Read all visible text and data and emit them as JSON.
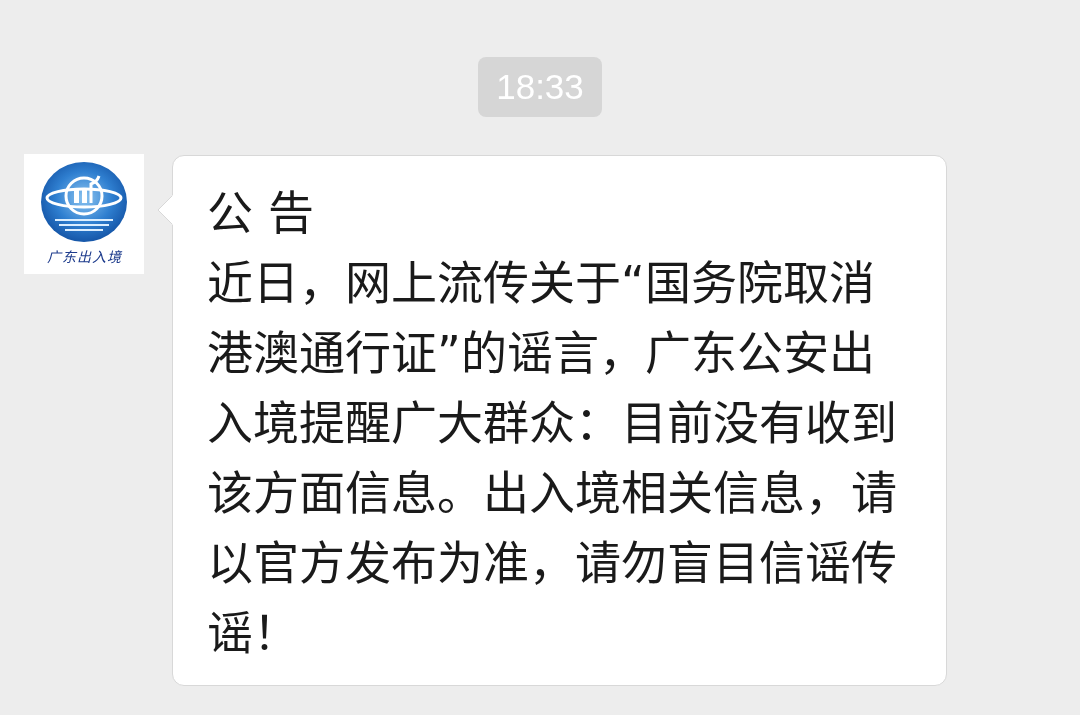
{
  "timestamp": "18:33",
  "messages": [
    {
      "avatar_caption": "广东出入境",
      "title": "公 告",
      "body": "近日，网上流传关于“国务院取消港澳通行证”的谣言，广东公安出入境提醒广大群众：目前没有收到该方面信息。出入境相关信息，请以官方发布为准，请勿盲目信谣传谣！"
    }
  ]
}
